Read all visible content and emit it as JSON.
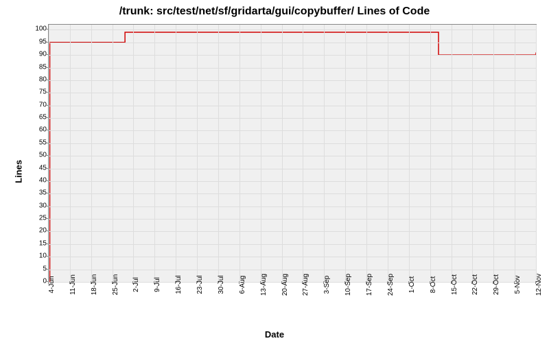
{
  "chart_data": {
    "type": "line",
    "title": "/trunk: src/test/net/sf/gridarta/gui/copybuffer/ Lines of Code",
    "xlabel": "Date",
    "ylabel": "Lines",
    "ylim": [
      0,
      102
    ],
    "y_ticks": [
      0,
      5,
      10,
      15,
      20,
      25,
      30,
      35,
      40,
      45,
      50,
      55,
      60,
      65,
      70,
      75,
      80,
      85,
      90,
      95,
      100
    ],
    "x_categories": [
      "4-Jun",
      "11-Jun",
      "18-Jun",
      "25-Jun",
      "2-Jul",
      "9-Jul",
      "16-Jul",
      "23-Jul",
      "30-Jul",
      "6-Aug",
      "13-Aug",
      "20-Aug",
      "27-Aug",
      "3-Sep",
      "10-Sep",
      "17-Sep",
      "24-Sep",
      "1-Oct",
      "8-Oct",
      "15-Oct",
      "22-Oct",
      "29-Oct",
      "5-Nov",
      "12-Nov"
    ],
    "series": [
      {
        "name": "Lines of Code",
        "color": "#d00000",
        "points": [
          {
            "x_idx": 0.05,
            "y": 0
          },
          {
            "x_idx": 0.05,
            "y": 95
          },
          {
            "x_idx": 3.6,
            "y": 95
          },
          {
            "x_idx": 3.6,
            "y": 99
          },
          {
            "x_idx": 18.4,
            "y": 99
          },
          {
            "x_idx": 18.4,
            "y": 90
          },
          {
            "x_idx": 23.0,
            "y": 90
          },
          {
            "x_idx": 23.0,
            "y": 91
          }
        ]
      }
    ]
  }
}
